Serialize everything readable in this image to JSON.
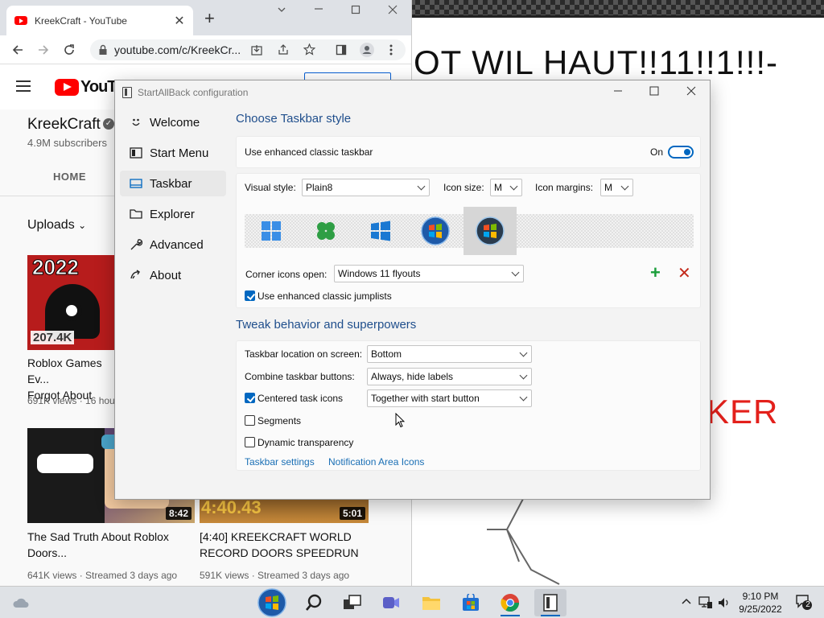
{
  "background_viewer": {
    "headline": "OT WIL HAUT!!11!!1!!!-",
    "red_text": "KER"
  },
  "chrome": {
    "tab_title": "KreekCraft - YouTube",
    "tab_close": "✕",
    "new_tab": "+",
    "url": "youtube.com/c/KreekCr...",
    "youtube_logo_text": "YouTu",
    "channel_name": "KreekCraft",
    "subscribers": "4.9M subscribers",
    "channel_tab": "HOME",
    "uploads_label": "Uploads",
    "videos": [
      {
        "thumb_top": "2022",
        "thumb_views": "207.4K",
        "title": "Roblox Games Ev...\nForgot About",
        "meta": "691K views · 16 hou"
      },
      {
        "duration": "8:42",
        "title": "The Sad Truth About Roblox Doors...",
        "meta": "641K views · Streamed 3 days ago"
      },
      {
        "duration": "5:01",
        "thumb_time": "4:40.43",
        "title": "[4:40] KREEKCRAFT WORLD RECORD DOORS SPEEDRUN",
        "meta": "591K views · Streamed 3 days ago"
      }
    ]
  },
  "sab": {
    "window_title": "StartAllBack configuration",
    "nav": [
      {
        "label": "Welcome",
        "icon": "smile-icon"
      },
      {
        "label": "Start Menu",
        "icon": "start-menu-icon"
      },
      {
        "label": "Taskbar",
        "icon": "taskbar-icon"
      },
      {
        "label": "Explorer",
        "icon": "folder-icon"
      },
      {
        "label": "Advanced",
        "icon": "wrench-icon"
      },
      {
        "label": "About",
        "icon": "about-icon"
      }
    ],
    "active_nav": "Taskbar",
    "section_taskbar_style": "Choose Taskbar style",
    "enhanced_classic_taskbar": "Use enhanced classic taskbar",
    "toggle_state": "On",
    "visual_style_label": "Visual style:",
    "visual_style_value": "Plain8",
    "icon_size_label": "Icon size:",
    "icon_size_value": "M",
    "icon_margins_label": "Icon margins:",
    "icon_margins_value": "M",
    "style_options": [
      "windows-11-style-icon",
      "clover-style-icon",
      "windows-10-style-icon",
      "windows-7-style-icon",
      "windows-vista-style-icon"
    ],
    "selected_style_index": 4,
    "corner_icons_label": "Corner icons open:",
    "corner_icons_value": "Windows 11 flyouts",
    "add_symbol": "+",
    "remove_symbol": "✕",
    "jumplists_label": "Use enhanced classic jumplists",
    "jumplists_checked": true,
    "section_tweak": "Tweak behavior and superpowers",
    "location_label": "Taskbar location on screen:",
    "location_value": "Bottom",
    "combine_label": "Combine taskbar buttons:",
    "combine_value": "Always, hide labels",
    "centered_label": "Centered task icons",
    "centered_checked": true,
    "centered_value": "Together with start button",
    "segments_label": "Segments",
    "segments_checked": false,
    "transparency_label": "Dynamic transparency",
    "transparency_checked": false,
    "link_taskbar_settings": "Taskbar settings",
    "link_notification_icons": "Notification Area Icons"
  },
  "taskbar": {
    "time": "9:10 PM",
    "date": "9/25/2022",
    "notification_count": "2",
    "pinned": [
      "start-orb-icon",
      "search-icon",
      "task-view-icon",
      "teams-chat-icon",
      "file-explorer-icon",
      "microsoft-store-icon",
      "chrome-icon",
      "startallback-icon"
    ]
  },
  "colors": {
    "accent": "#0067c0",
    "section_title": "#1f4e8c",
    "link": "#1a6fb5",
    "add_green": "#1a9e3a",
    "remove_red": "#c42b1c"
  }
}
